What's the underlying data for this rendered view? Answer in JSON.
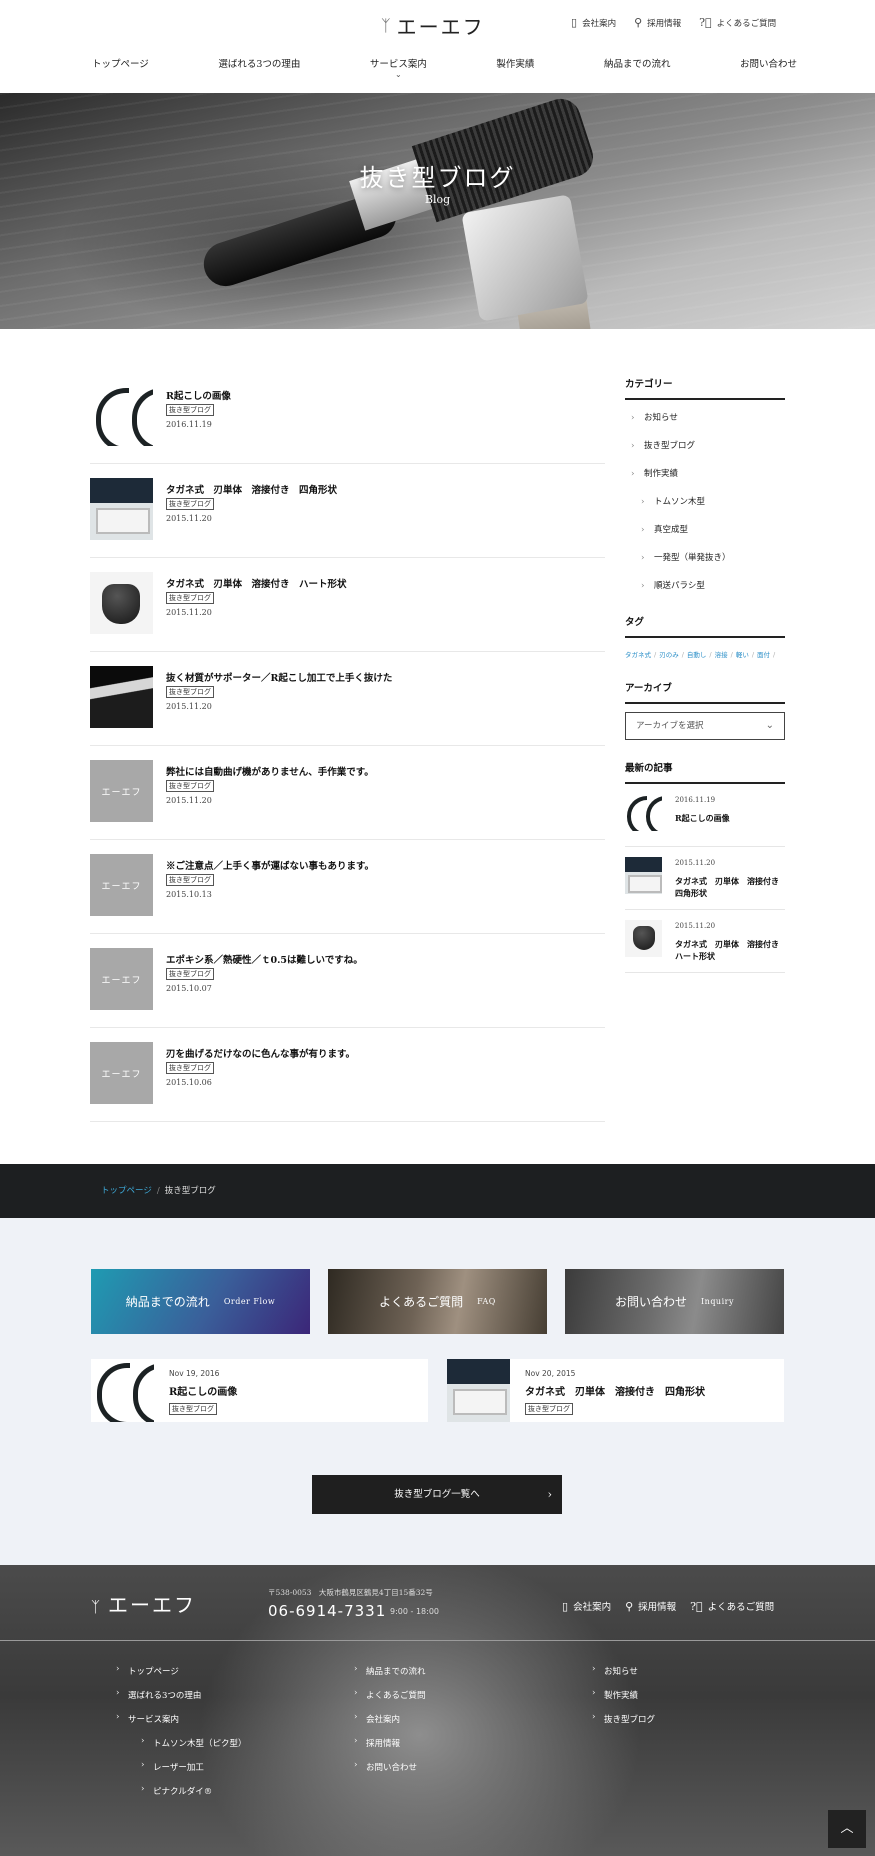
{
  "header": {
    "logo": "エーエフ",
    "links": [
      {
        "label": "会社案内",
        "icon": "building-icon"
      },
      {
        "label": "採用情報",
        "icon": "person-icon"
      },
      {
        "label": "よくあるご質問",
        "icon": "question-circle-icon"
      }
    ],
    "nav": [
      "トップページ",
      "選ばれる3つの理由",
      "サービス案内",
      "製作実績",
      "納品までの流れ",
      "お問い合わせ"
    ]
  },
  "hero": {
    "title": "抜き型ブログ",
    "subtitle": "Blog"
  },
  "posts": [
    {
      "title": "R起こしの画像",
      "category": "抜き型ブログ",
      "date": "2016.11.19",
      "thumb": "arcs"
    },
    {
      "title": "タガネ式　刃単体　溶接付き　四角形状",
      "category": "抜き型ブログ",
      "date": "2015.11.20",
      "thumb": "box"
    },
    {
      "title": "タガネ式　刃単体　溶接付き　ハート形状",
      "category": "抜き型ブログ",
      "date": "2015.11.20",
      "thumb": "cup"
    },
    {
      "title": "抜く材質がサポーター／R起こし加工で上手く抜けた",
      "category": "抜き型ブログ",
      "date": "2015.11.20",
      "thumb": "mat"
    },
    {
      "title": "弊社には自動曲げ機がありません、手作業です。",
      "category": "抜き型ブログ",
      "date": "2015.11.20",
      "thumb": "grey"
    },
    {
      "title": "※ご注意点／上手く事が運ばない事もあります。",
      "category": "抜き型ブログ",
      "date": "2015.10.13",
      "thumb": "grey"
    },
    {
      "title": "エポキシ系／熱硬性／ｔ0.5は難しいですね。",
      "category": "抜き型ブログ",
      "date": "2015.10.07",
      "thumb": "grey"
    },
    {
      "title": "刃を曲げるだけなのに色んな事が有ります。",
      "category": "抜き型ブログ",
      "date": "2015.10.06",
      "thumb": "grey"
    }
  ],
  "placeholder_logo": "エーエフ",
  "sidebar": {
    "category_heading": "カテゴリー",
    "categories": [
      {
        "label": "お知らせ",
        "sub": false
      },
      {
        "label": "抜き型ブログ",
        "sub": false
      },
      {
        "label": "制作実績",
        "sub": false
      },
      {
        "label": "トムソン木型",
        "sub": true
      },
      {
        "label": "真空成型",
        "sub": true
      },
      {
        "label": "一発型（単発抜き）",
        "sub": true
      },
      {
        "label": "順送パラシ型",
        "sub": true
      }
    ],
    "tag_heading": "タグ",
    "tags": [
      "タガネ式",
      "刃のみ",
      "自動し",
      "溶接",
      "軽い",
      "面付"
    ],
    "archive_heading": "アーカイブ",
    "archive_select": "アーカイブを選択",
    "recent_heading": "最新の記事",
    "recent": [
      {
        "date": "2016.11.19",
        "title": "R起こしの画像",
        "thumb": "arcs"
      },
      {
        "date": "2015.11.20",
        "title": "タガネ式　刃単体　溶接付き　四角形状",
        "thumb": "box"
      },
      {
        "date": "2015.11.20",
        "title": "タガネ式　刃単体　溶接付き　ハート形状",
        "thumb": "cup"
      }
    ]
  },
  "breadcrumb": {
    "home": "トップページ",
    "sep": "/",
    "current": "抜き型ブログ"
  },
  "banners": [
    {
      "jp": "納品までの流れ",
      "en": "Order Flow"
    },
    {
      "jp": "よくあるご質問",
      "en": "FAQ"
    },
    {
      "jp": "お問い合わせ",
      "en": "Inquiry"
    }
  ],
  "cards": [
    {
      "date": "Nov 19, 2016",
      "title": "R起こしの画像",
      "category": "抜き型ブログ",
      "thumb": "arcs"
    },
    {
      "date": "Nov 20, 2015",
      "title": "タガネ式　刃単体　溶接付き　四角形状",
      "category": "抜き型ブログ",
      "thumb": "box"
    }
  ],
  "more_button": "抜き型ブログ一覧へ",
  "footer": {
    "logo": "エーエフ",
    "address": "〒538-0053　大阪市鶴見区鶴見4丁目15番32号",
    "tel": "06-6914-7331",
    "hours": "9:00 - 18:00",
    "links": [
      {
        "label": "会社案内",
        "icon": "building-icon"
      },
      {
        "label": "採用情報",
        "icon": "person-icon"
      },
      {
        "label": "よくあるご質問",
        "icon": "question-circle-icon"
      }
    ],
    "col1": [
      {
        "label": "トップページ",
        "sub": false
      },
      {
        "label": "選ばれる3つの理由",
        "sub": false
      },
      {
        "label": "サービス案内",
        "sub": false
      },
      {
        "label": "トムソン木型（ピク型）",
        "sub": true
      },
      {
        "label": "レーザー加工",
        "sub": true
      },
      {
        "label": "ピナクルダイ®",
        "sub": true
      }
    ],
    "col2": [
      "納品までの流れ",
      "よくあるご質問",
      "会社案内",
      "採用情報",
      "お問い合わせ"
    ],
    "col3": [
      "お知らせ",
      "製作実績",
      "抜き型ブログ"
    ]
  }
}
